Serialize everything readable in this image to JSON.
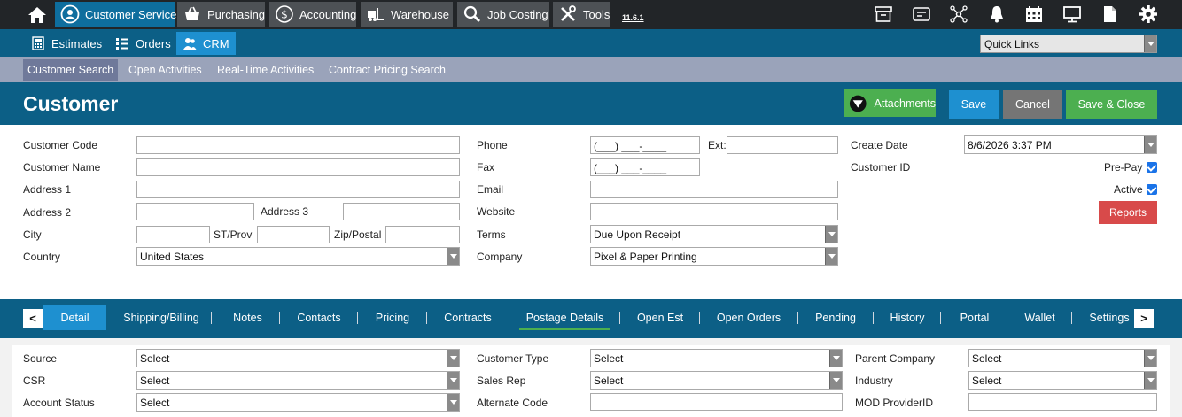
{
  "topnav": {
    "modules": [
      {
        "label": "Customer Service",
        "icon": "customer-service-icon"
      },
      {
        "label": "Purchasing",
        "icon": "basket-icon"
      },
      {
        "label": "Accounting",
        "icon": "dollar-icon"
      },
      {
        "label": "Warehouse",
        "icon": "forklift-icon"
      },
      {
        "label": "Job Costing",
        "icon": "magnifier-icon"
      },
      {
        "label": "Tools",
        "icon": "tools-icon"
      }
    ],
    "version": "11.6.1",
    "right_icons": [
      "archive-icon",
      "id-card-icon",
      "network-icon",
      "bell-icon",
      "calendar-icon",
      "monitor-icon",
      "document-icon",
      "gear-icon"
    ]
  },
  "subnav": {
    "items": [
      {
        "label": "Estimates",
        "icon": "calculator-icon"
      },
      {
        "label": "Orders",
        "icon": "list-icon"
      },
      {
        "label": "CRM",
        "icon": "people-icon"
      }
    ],
    "quick_links": "Quick Links"
  },
  "tertnav": [
    "Customer Search",
    "Open Activities",
    "Real-Time Activities",
    "Contract Pricing Search"
  ],
  "header": {
    "title": "Customer",
    "attachments": "Attachments",
    "save": "Save",
    "cancel": "Cancel",
    "save_close": "Save & Close"
  },
  "form": {
    "customer_code": "Customer Code",
    "customer_name": "Customer Name",
    "address1": "Address 1",
    "address2": "Address 2",
    "address3": "Address 3",
    "city": "City",
    "st_prov": "ST/Prov",
    "zip": "Zip/Postal",
    "country": "Country",
    "country_value": "United States",
    "phone": "Phone",
    "phone_value": "(___) ___-____",
    "ext": "Ext:",
    "fax": "Fax",
    "fax_value": "(___) ___-____",
    "email": "Email",
    "website": "Website",
    "terms": "Terms",
    "terms_value": "Due Upon Receipt",
    "company": "Company",
    "company_value": "Pixel & Paper Printing",
    "create_date": "Create Date",
    "create_date_value": "8/6/2026 3:37 PM",
    "customer_id": "Customer ID",
    "prepay": "Pre-Pay",
    "active": "Active",
    "reports": "Reports"
  },
  "tabs": [
    "Detail",
    "Shipping/Billing",
    "Notes",
    "Contacts",
    "Pricing",
    "Contracts",
    "Postage Details",
    "Open Est",
    "Open Orders",
    "Pending",
    "History",
    "Portal",
    "Wallet",
    "Settings"
  ],
  "tab_prev": "<",
  "tab_next": ">",
  "detail": {
    "source": "Source",
    "csr": "CSR",
    "account_status": "Account Status",
    "customer_type": "Customer Type",
    "sales_rep": "Sales Rep",
    "alternate_code": "Alternate Code",
    "parent_company": "Parent Company",
    "industry": "Industry",
    "mod_provider": "MOD ProviderID",
    "select": "Select"
  }
}
